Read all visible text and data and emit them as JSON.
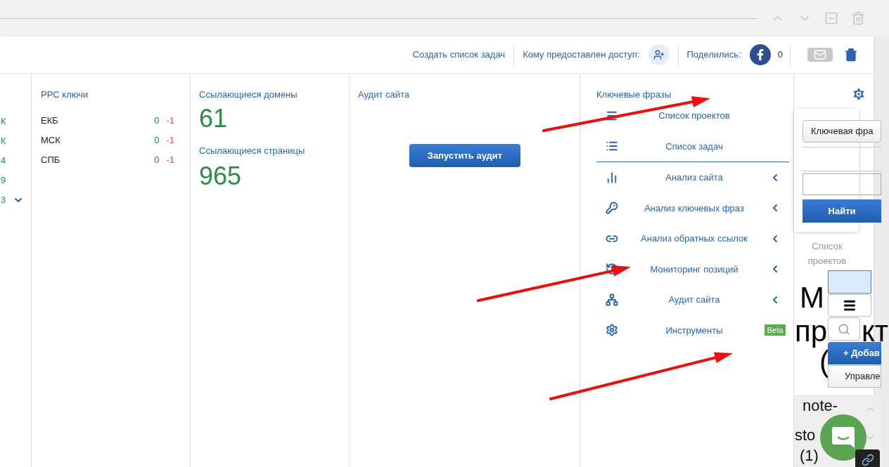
{
  "header": {
    "create_task_list": "Создать список задач",
    "access_label": "Кому предоставлен доступ:",
    "shared_label": "Поделились:",
    "shared_count": "0"
  },
  "cut_column": {
    "values": [
      "К",
      "К",
      "4",
      "9",
      "3"
    ]
  },
  "ppc": {
    "title": "PPC ключи",
    "rows": [
      {
        "region": "ЕКБ",
        "value": "0",
        "change": "-1"
      },
      {
        "region": "МСК",
        "value": "0",
        "change": "-1"
      },
      {
        "region": "СПБ",
        "value": "0",
        "change": "-1"
      }
    ]
  },
  "links": {
    "domains_title": "Ссылающиеся домены",
    "domains_value": "61",
    "pages_title": "Ссылающиеся страницы",
    "pages_value": "965"
  },
  "audit": {
    "title": "Аудит сайта",
    "button": "Запустить аудит"
  },
  "keywords": {
    "title": "Ключевые фразы",
    "menu_groups": [
      [
        {
          "label": "Список проектов",
          "kind": "link"
        },
        {
          "label": "Список задач",
          "kind": "link"
        }
      ],
      [
        {
          "label": "Анализ сайта",
          "kind": "submenu"
        },
        {
          "label": "Анализ ключевых фраз",
          "kind": "submenu"
        },
        {
          "label": "Анализ обратных ссылок",
          "kind": "submenu"
        },
        {
          "label": "Мониторинг позиций",
          "kind": "submenu"
        },
        {
          "label": "Аудит сайта",
          "kind": "submenu"
        },
        {
          "label": "Инструменты",
          "kind": "badge",
          "badge": "Beta"
        }
      ]
    ]
  },
  "search_widget": {
    "type_button": "Ключевая фра",
    "find_button": "Найти"
  },
  "projects_label": "Список проектов",
  "overlapped_heading": [
    "М",
    "пр",
    "кт",
    "("
  ],
  "project_buttons": {
    "add": "+ Добав",
    "manage": "Управле"
  },
  "note_section": {
    "lines": [
      "note-",
      "sto",
      "(1)"
    ]
  },
  "annotations": [
    {
      "kind": "arrow"
    },
    {
      "kind": "arrow"
    },
    {
      "kind": "arrow"
    }
  ]
}
